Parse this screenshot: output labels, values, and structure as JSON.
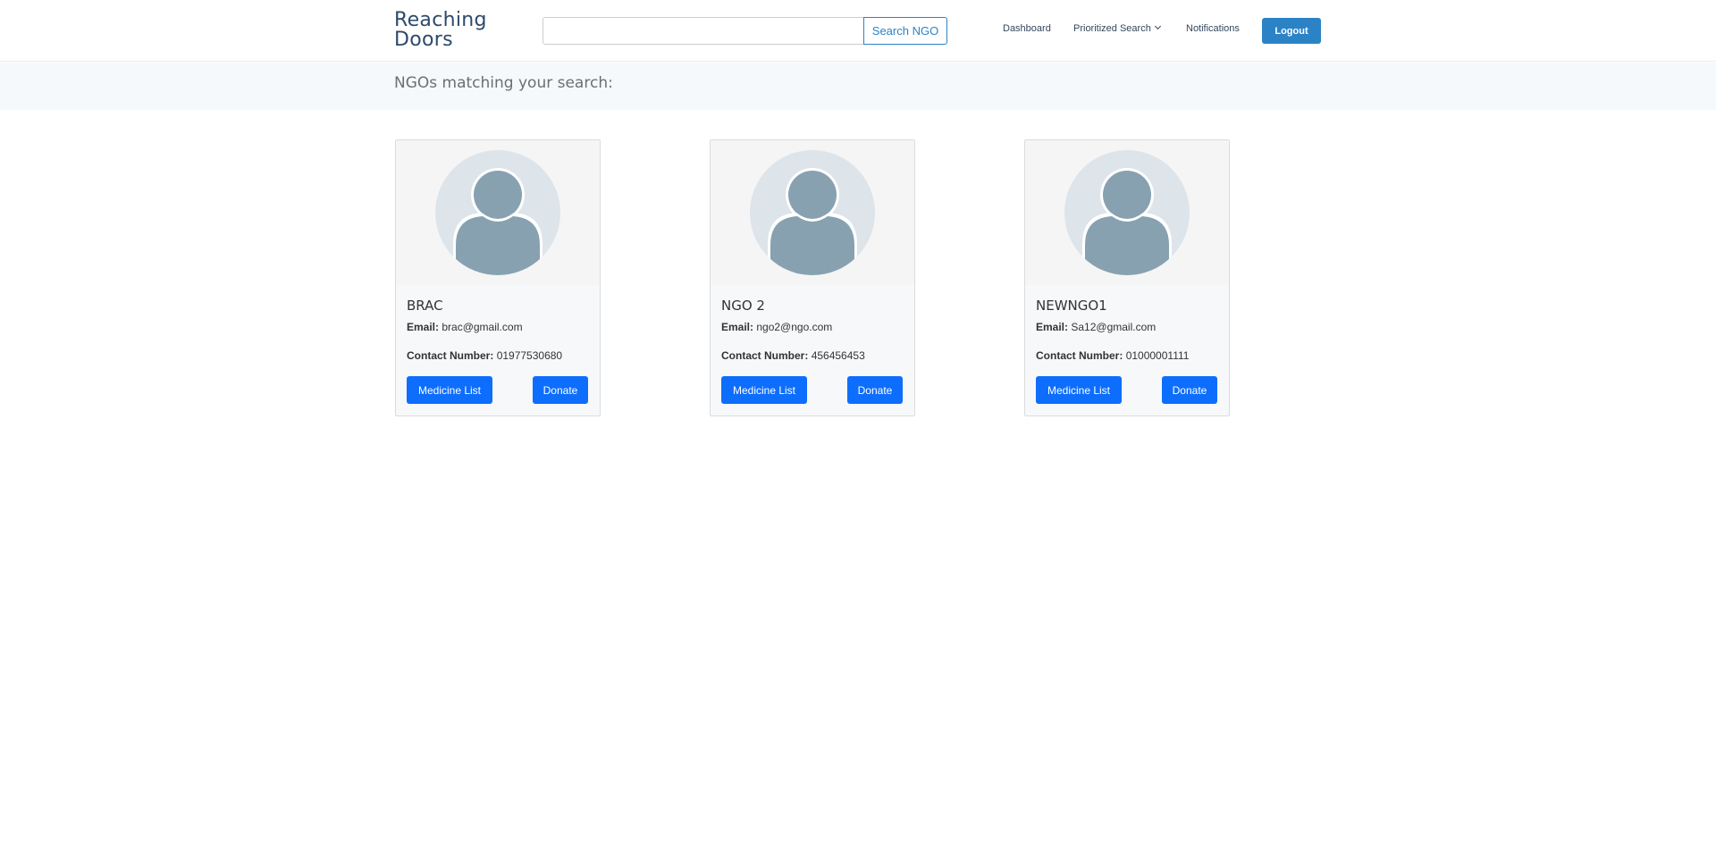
{
  "header": {
    "brand_line1": "Reaching",
    "brand_line2": "Doors",
    "search": {
      "value": "",
      "placeholder": "",
      "button_label": "Search NGO"
    },
    "nav": {
      "dashboard": "Dashboard",
      "prioritized_search": "Prioritized Search",
      "notifications": "Notifications"
    },
    "logout_label": "Logout"
  },
  "banner": {
    "title": "NGOs matching your search:"
  },
  "labels": {
    "email": "Email:",
    "contact": "Contact Number:",
    "medicine_list": "Medicine List",
    "donate": "Donate"
  },
  "ngos": [
    {
      "name": "BRAC",
      "email": "brac@gmail.com",
      "contact": "01977530680"
    },
    {
      "name": "NGO 2",
      "email": "ngo2@ngo.com",
      "contact": "456456453"
    },
    {
      "name": "NEWNGO1",
      "email": "Sa12@gmail.com",
      "contact": "01000001111"
    }
  ],
  "colors": {
    "brand": "#2d4a6b",
    "accent": "#2b83c6",
    "primary_button": "#0d6efd",
    "banner_bg": "#f5f9fb",
    "avatar_bg": "#dde4ea",
    "avatar_fg": "#87a1b0"
  },
  "icons": {
    "avatar": "user-avatar-icon",
    "dropdown": "chevron-down-icon"
  }
}
